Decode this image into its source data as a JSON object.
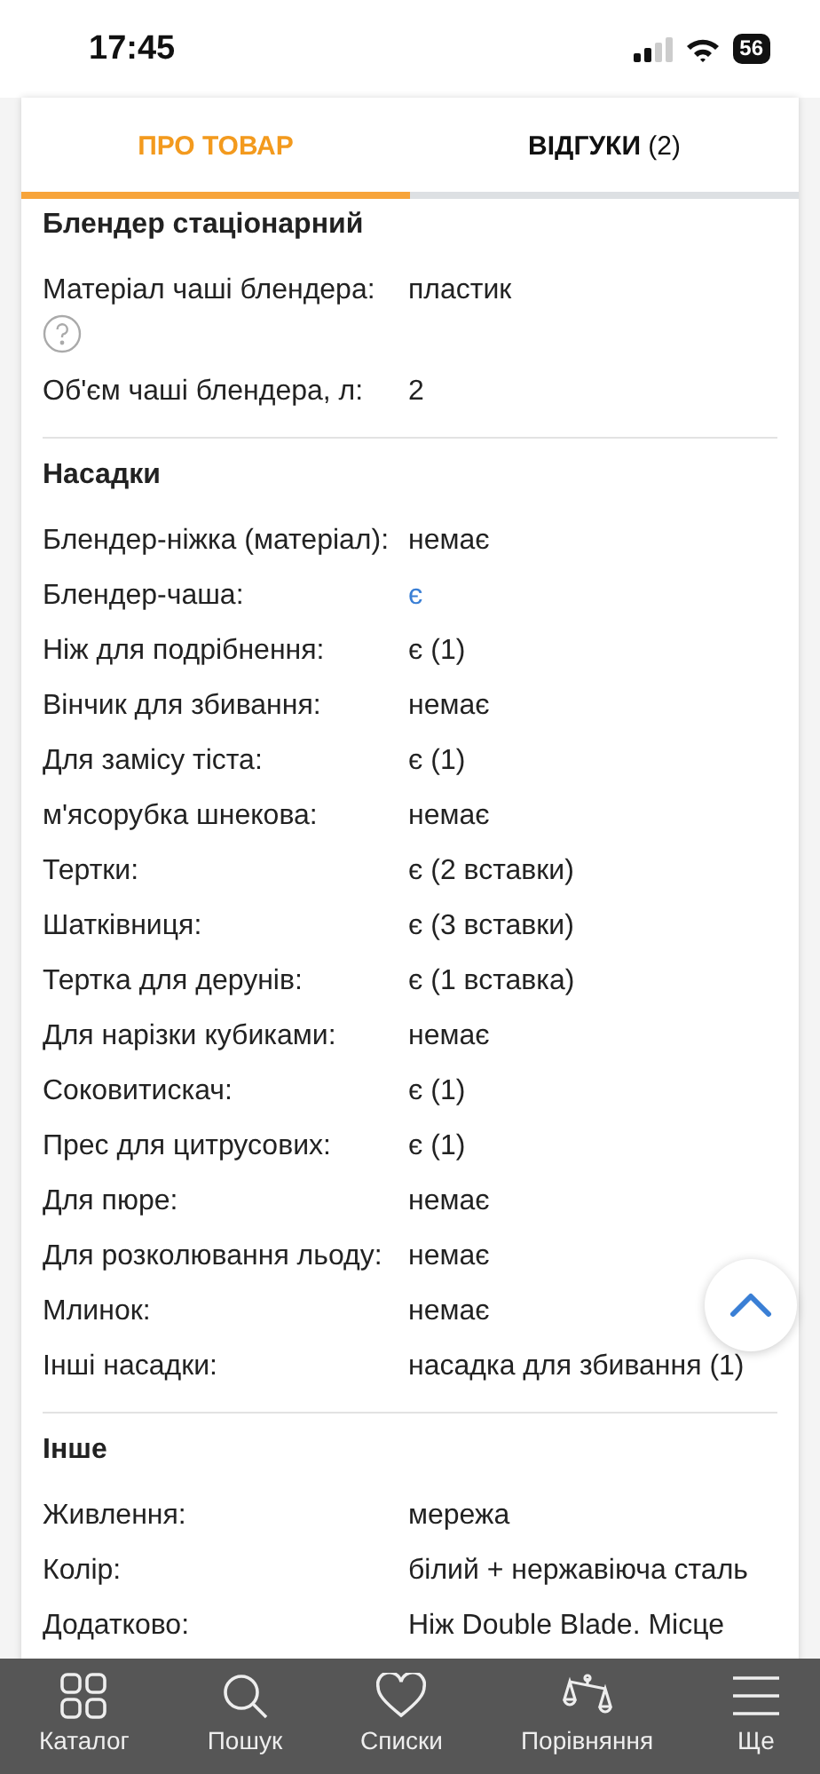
{
  "status_bar": {
    "time": "17:45",
    "battery": "56"
  },
  "tabs": [
    {
      "label": "ПРО ТОВАР",
      "selected": true
    },
    {
      "label": "**ВІДГУКИ** (2)",
      "selected": false
    }
  ],
  "sections": [
    {
      "title": "Блендер стаціонарний",
      "rows": [
        {
          "label": "Матеріал чаші блендера:",
          "value": "пластик",
          "kind": "help"
        },
        {
          "label": "Об'єм чаші блендера, л:",
          "value": "2",
          "kind": "text"
        }
      ]
    },
    {
      "title": "Насадки",
      "rows": [
        {
          "label": "Блендер-ніжка (матеріал):",
          "value": "немає",
          "kind": "text"
        },
        {
          "label": "Блендер-чаша:",
          "value": "є",
          "kind": "link"
        },
        {
          "label": "Ніж для подрібнення:",
          "value": "є (1)",
          "kind": "text"
        },
        {
          "label": "Вінчик для збивання:",
          "value": "немає",
          "kind": "text"
        },
        {
          "label": "Для замісу тіста:",
          "value": "є (1)",
          "kind": "text"
        },
        {
          "label": "м'ясорубка шнекова:",
          "value": "немає",
          "kind": "text"
        },
        {
          "label": "Тертки:",
          "value": "є (2 вставки)",
          "kind": "text"
        },
        {
          "label": "Шатківниця:",
          "value": "є (3 вставки)",
          "kind": "text"
        },
        {
          "label": "Тертка для дерунів:",
          "value": "є (1 вставка)",
          "kind": "text"
        },
        {
          "label": "Для нарізки кубиками:",
          "value": "немає",
          "kind": "text"
        },
        {
          "label": "Соковитискач:",
          "value": "є (1)",
          "kind": "text"
        },
        {
          "label": "Прес для цитрусових:",
          "value": "є (1)",
          "kind": "text"
        },
        {
          "label": "Для пюре:",
          "value": "немає",
          "kind": "text"
        },
        {
          "label": "Для розколювання льоду:",
          "value": "немає",
          "kind": "text"
        },
        {
          "label": "Млинок:",
          "value": "немає",
          "kind": "text"
        },
        {
          "label": "Інші насадки:",
          "value": "насадка для збивання (1)",
          "kind": "text"
        }
      ]
    },
    {
      "title": "Інше",
      "rows": [
        {
          "label": "Живлення:",
          "value": "мережа",
          "kind": "text"
        },
        {
          "label": "Колір:",
          "value": "білий + нержавіюча сталь",
          "kind": "text"
        },
        {
          "label": "Додатково:",
          "value": "Ніж Double Blade. Місце",
          "kind": "text"
        }
      ]
    }
  ],
  "bottom_nav": [
    {
      "label": "Каталог"
    },
    {
      "label": "Пошук"
    },
    {
      "label": "Списки"
    },
    {
      "label": "Порівняння"
    },
    {
      "label": "Ще"
    }
  ]
}
